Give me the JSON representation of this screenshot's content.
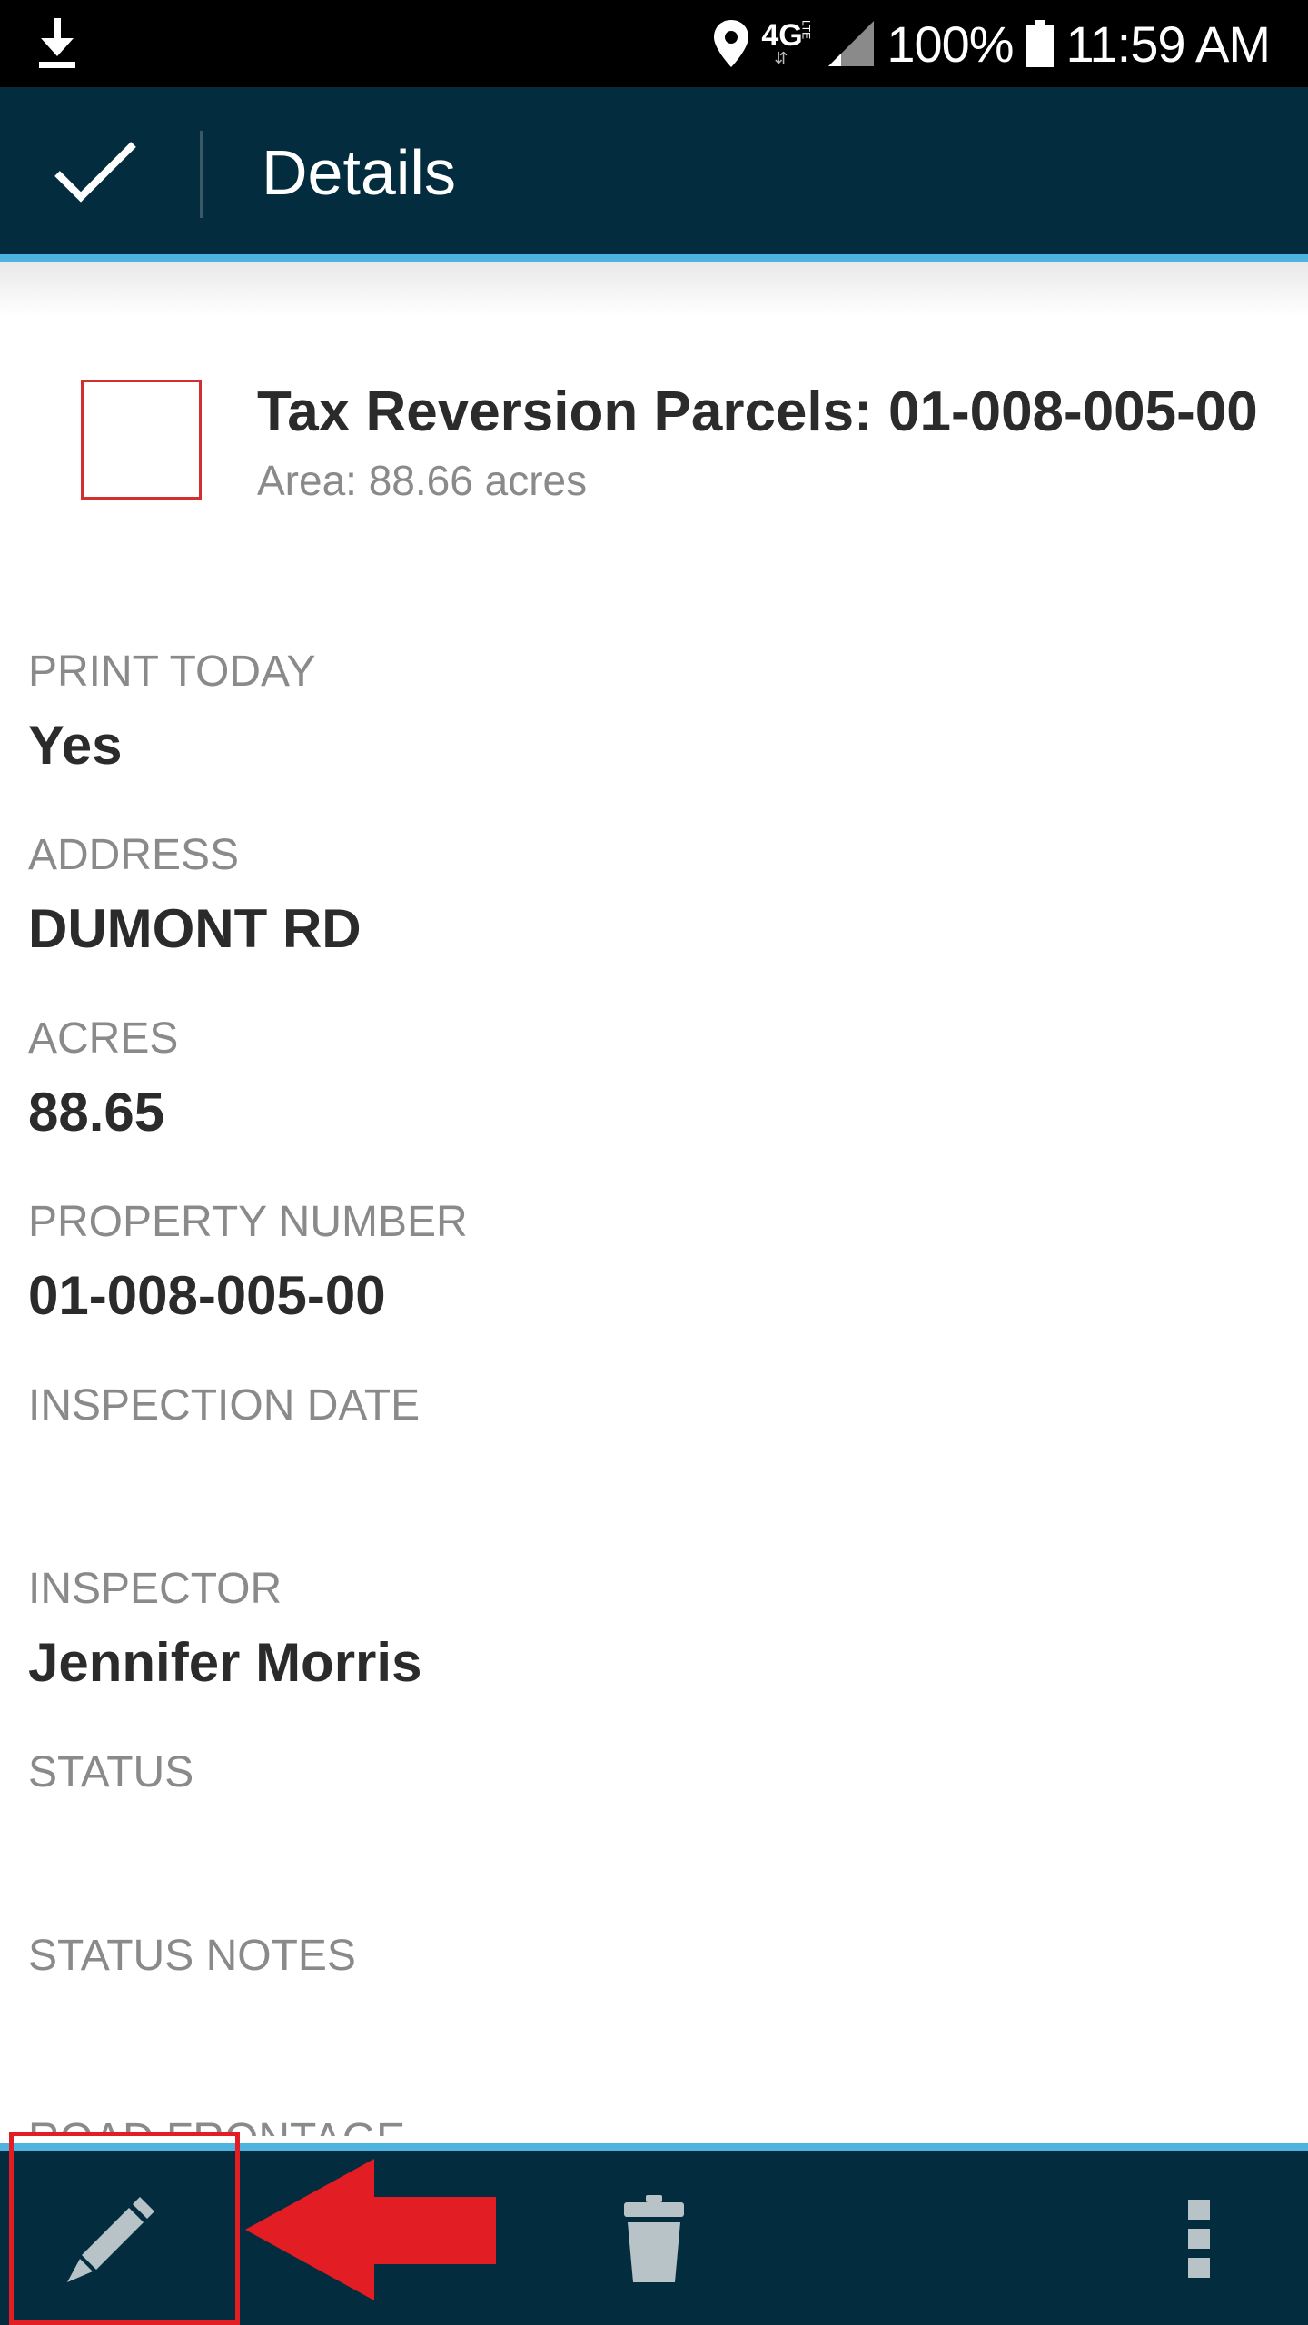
{
  "status_bar": {
    "download_icon": "download-icon",
    "location_icon": "location-pin-icon",
    "network_label": "4G",
    "network_sub": "LTE",
    "signal_icon": "signal-icon",
    "battery_percent": "100%",
    "battery_icon": "battery-icon",
    "time": "11:59 AM"
  },
  "app_bar": {
    "done_icon": "checkmark-icon",
    "title": "Details",
    "background_color": "#032d3e",
    "accent_color": "#4fb3e0"
  },
  "feature": {
    "symbol_color": "#d32f2f",
    "title": "Tax Reversion Parcels: 01-008-005-00",
    "subtitle": "Area: 88.66 acres"
  },
  "fields": [
    {
      "label": "PRINT TODAY",
      "value": "Yes"
    },
    {
      "label": "ADDRESS",
      "value": "DUMONT RD"
    },
    {
      "label": "ACRES",
      "value": "88.65"
    },
    {
      "label": "PROPERTY NUMBER",
      "value": "01-008-005-00"
    },
    {
      "label": "INSPECTION DATE",
      "value": ""
    },
    {
      "label": "INSPECTOR",
      "value": "Jennifer Morris"
    },
    {
      "label": "STATUS",
      "value": ""
    },
    {
      "label": "STATUS NOTES",
      "value": ""
    }
  ],
  "partially_visible_field_label": "ROAD FRONTAGE",
  "toolbar": {
    "edit_icon": "pencil-icon",
    "delete_icon": "trash-icon",
    "overflow_icon": "more-vert-icon"
  },
  "annotation": {
    "highlight_color": "#e21d24",
    "arrow_icon": "red-arrow-left-icon"
  }
}
